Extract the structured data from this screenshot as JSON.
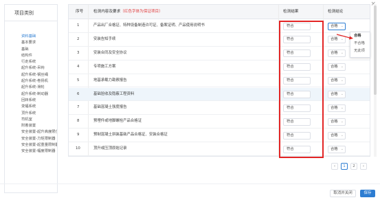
{
  "window": {
    "close_glyph": "×"
  },
  "sidebar": {
    "title": "项目类别",
    "items": [
      "资料基础",
      "基本要求",
      "基础",
      "结构件",
      "行走系统",
      "起升系统-吊钩",
      "起升系统-钢丝绳",
      "起升系统-卷扬机",
      "起升系统-滑轮",
      "起升系统-制动器",
      "回转系统",
      "变幅系统",
      "顶升系统",
      "司机室",
      "附着装置",
      "安全装置-起升高度限位器",
      "安全装置-力矩限制器",
      "安全装置-起重量限制器",
      "安全装置-幅度限制器"
    ],
    "active_index": 0
  },
  "table": {
    "headers": {
      "index": "序号",
      "content_prefix": "检测内容及要求",
      "content_note": "（红色字体为保证项目）",
      "result": "检测结果",
      "conclusion": "检测结论"
    },
    "rows": [
      {
        "no": "1",
        "content": "产品出厂合格证、特种设备制造许可证、备案证明、产品使用说明书",
        "result": "符合",
        "conclusion": "合格"
      },
      {
        "no": "2",
        "content": "安装告知手续",
        "result": "符合",
        "conclusion": "合格"
      },
      {
        "no": "3",
        "content": "安装合同及安全协议",
        "result": "符合",
        "conclusion": "合格"
      },
      {
        "no": "4",
        "content": "专项施工方案",
        "result": "符合",
        "conclusion": "合格"
      },
      {
        "no": "5",
        "content": "地基承载力勘察报告",
        "result": "符合",
        "conclusion": "合格"
      },
      {
        "no": "6",
        "content": "基础验收及隐蔽工程资料",
        "result": "符合",
        "conclusion": "合格"
      },
      {
        "no": "7",
        "content": "基础混凝土强度报告",
        "result": "符合",
        "conclusion": "合格"
      },
      {
        "no": "8",
        "content": "预埋件或地脚螺栓产品合格证",
        "result": "符合",
        "conclusion": "合格"
      },
      {
        "no": "9",
        "content": "预制混凝土拼装基础产品合格证、安装合格证",
        "result": "符合",
        "conclusion": "合格"
      },
      {
        "no": "10",
        "content": "顶升或压顶原始记录",
        "result": "符合",
        "conclusion": "合格"
      }
    ],
    "highlighted_row": 5
  },
  "dropdown": {
    "options": [
      "合格",
      "不合格",
      "无此项"
    ],
    "selected": "合格"
  },
  "pagination": {
    "prev": "‹",
    "pages": [
      "1",
      "2"
    ],
    "current": "1",
    "next": "›"
  },
  "footer": {
    "cancel_label": "取消并关闭",
    "save_label": "保存"
  },
  "colors": {
    "accent": "#2d7dd2",
    "highlight_frame": "#e32424",
    "note_red": "#e03b3b"
  }
}
